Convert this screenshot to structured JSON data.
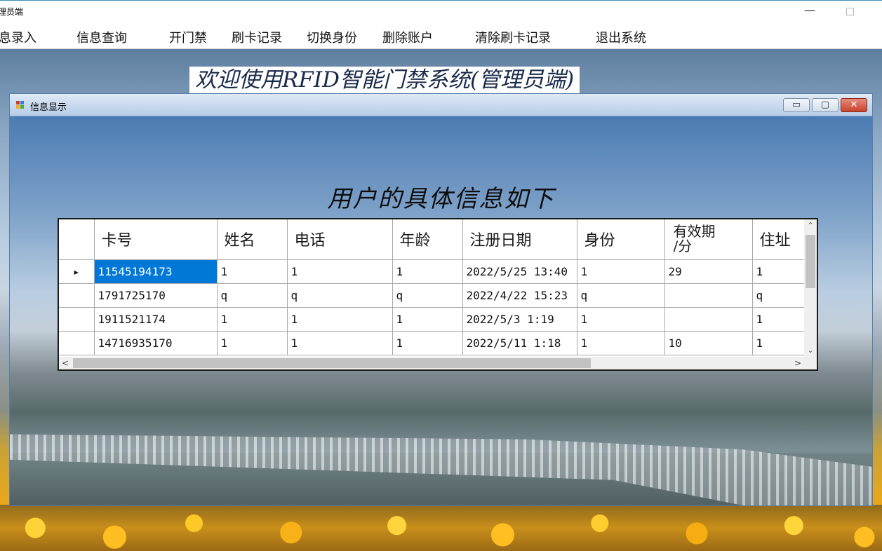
{
  "window": {
    "title": "理员端",
    "minimize_glyph": "—"
  },
  "menu": {
    "items": [
      "息录入",
      "信息查询",
      "开门禁",
      "刷卡记录",
      "切换身份",
      "删除账户",
      "清除刷卡记录",
      "退出系统"
    ]
  },
  "background": {
    "caption": "欢迎使用RFID智能门禁系统(管理员端)"
  },
  "child_window": {
    "title": "信息显示",
    "heading": "用户的具体信息如下",
    "buttons": {
      "minimize": "▭",
      "maximize": "▢",
      "close": "✕"
    }
  },
  "grid": {
    "columns": [
      "卡号",
      "姓名",
      "电话",
      "年龄",
      "注册日期",
      "身份",
      "有效期\n/分",
      "住址"
    ],
    "current_row_marker": "▸",
    "rows": [
      [
        "11545194173",
        "1",
        "1",
        "1",
        "2022/5/25 13:40",
        "1",
        "29",
        "1"
      ],
      [
        "1791725170",
        "q",
        "q",
        "q",
        "2022/4/22 15:23",
        "q",
        "",
        "q"
      ],
      [
        "1911521174",
        "1",
        "1",
        "1",
        "2022/5/3 1:19",
        "1",
        "",
        "1"
      ],
      [
        "14716935170",
        "1",
        "1",
        "1",
        "2022/5/11 1:18",
        "1",
        "10",
        "1"
      ]
    ],
    "selected_row": 0,
    "scroll": {
      "up": "⌃",
      "down": "⌄",
      "left": "<",
      "right": ">"
    }
  },
  "colors": {
    "selection": "#0078d7",
    "grid_border": "#1b1b1b",
    "child_border": "#5a7ea8"
  }
}
